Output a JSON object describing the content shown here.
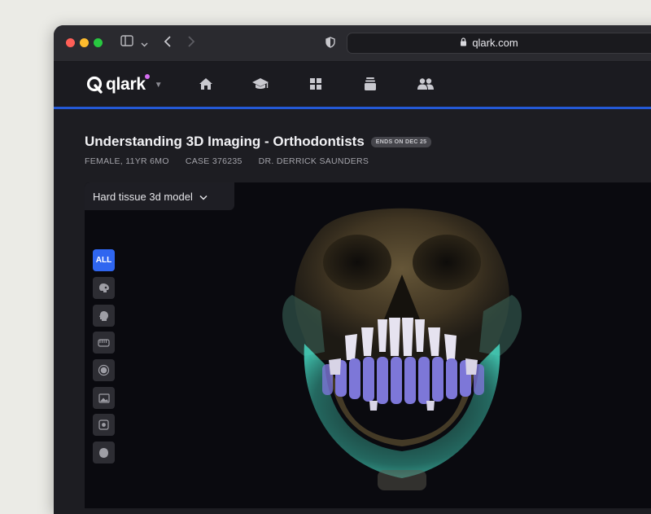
{
  "browser": {
    "url": "qlark.com",
    "icons": [
      "sidebar-toggle-icon",
      "chevron-down-icon",
      "back-icon",
      "forward-icon",
      "shield-icon",
      "lock-icon"
    ]
  },
  "app": {
    "logo": "qlark",
    "nav_icons": [
      "home-icon",
      "graduation-cap-icon",
      "grid-icon",
      "stack-icon",
      "users-icon"
    ],
    "accent_color": "#2459d6",
    "logo_dot_color": "#d56ef0"
  },
  "case": {
    "title": "Understanding 3D Imaging - Orthodontists",
    "badge": "ENDS ON DEC 25",
    "patient": "FEMALE, 11YR 6MO",
    "case_id": "CASE 376235",
    "doctor": "DR. DERRICK SAUNDERS"
  },
  "viewer": {
    "model_select": "Hard tissue 3d model",
    "tools": [
      {
        "label": "ALL",
        "icon": "all",
        "active": true
      },
      {
        "label": "",
        "icon": "skull-side-icon",
        "active": false
      },
      {
        "label": "",
        "icon": "head-profile-icon",
        "active": false
      },
      {
        "label": "",
        "icon": "teeth-icon",
        "active": false
      },
      {
        "label": "",
        "icon": "target-icon",
        "active": false
      },
      {
        "label": "",
        "icon": "image-icon",
        "active": false
      },
      {
        "label": "",
        "icon": "camera-icon",
        "active": false
      },
      {
        "label": "",
        "icon": "face-icon",
        "active": false
      }
    ]
  }
}
